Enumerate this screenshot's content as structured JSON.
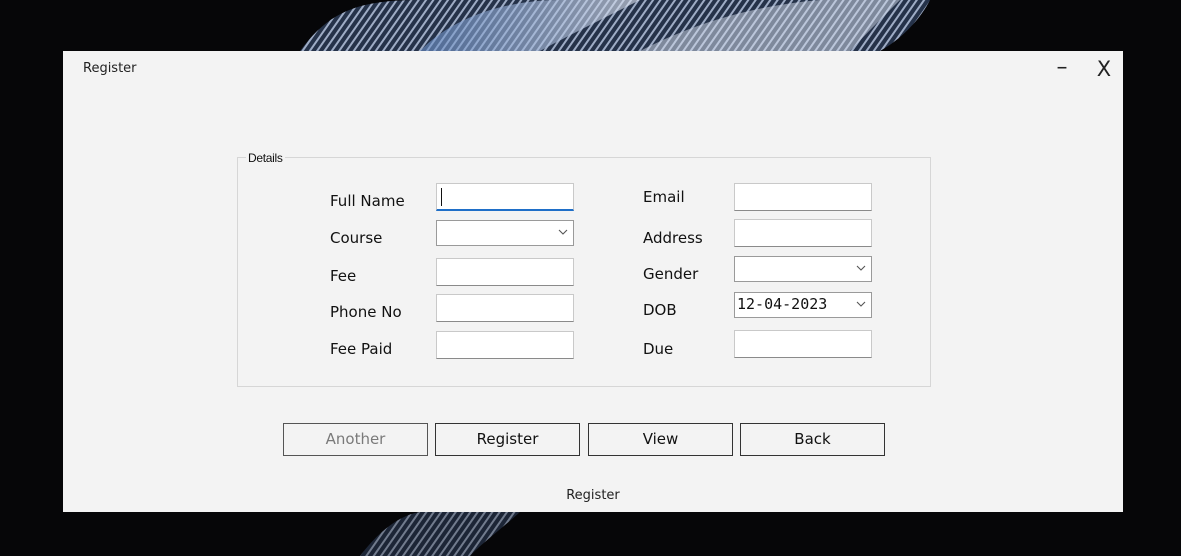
{
  "window": {
    "title": "Register",
    "minimize_label": "–",
    "close_label": "X"
  },
  "details": {
    "legend": "Details",
    "labels": {
      "full_name": "Full Name",
      "course": "Course",
      "fee": "Fee",
      "phone_no": "Phone No",
      "fee_paid": "Fee Paid",
      "email": "Email",
      "address": "Address",
      "gender": "Gender",
      "dob": "DOB",
      "due": "Due"
    },
    "values": {
      "full_name": "",
      "course": "",
      "fee": "",
      "phone_no": "",
      "fee_paid": "",
      "email": "",
      "address": "",
      "gender": "",
      "dob": "12-04-2023",
      "due": ""
    }
  },
  "buttons": {
    "another": "Another",
    "register": "Register",
    "view": "View",
    "back": "Back"
  },
  "status_text": "Register",
  "colors": {
    "window_bg": "#f3f3f3",
    "focus_accent": "#1f6fc8",
    "desktop_bg": "#060608"
  },
  "icons": {
    "dropdown": "chevron-down-icon"
  }
}
